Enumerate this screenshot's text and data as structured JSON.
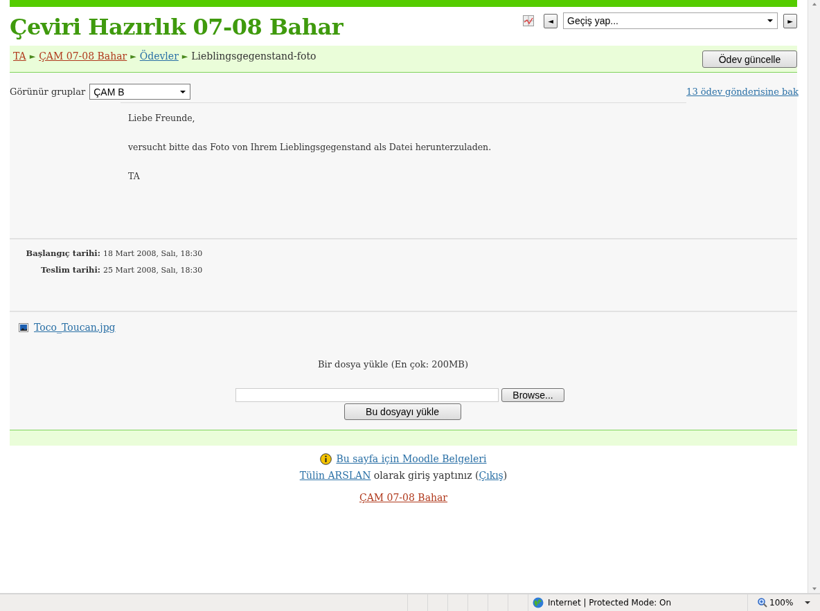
{
  "header": {
    "title": "Çeviri Hazırlık 07-08 Bahar",
    "jump": {
      "prev": "◄",
      "select": "Geçiş yap...",
      "next": "►"
    }
  },
  "breadcrumb": {
    "separator": "►",
    "items": [
      {
        "text": "TA",
        "kind": "course-link"
      },
      {
        "text": "ÇAM 07-08 Bahar",
        "kind": "course-link"
      },
      {
        "text": "Ödevler",
        "kind": "link"
      },
      {
        "text": "Lieblingsgegenstand-foto",
        "kind": "current"
      }
    ]
  },
  "update_button": "Ödev güncelle",
  "groups": {
    "label": "Görünür gruplar",
    "value": "ÇAM B"
  },
  "submissions_link": "13 ödev gönderisine bak",
  "intro": [
    "Liebe Freunde,",
    "versucht bitte das Foto von Ihrem Lieblingsgegenstand als Datei herunterzuladen.",
    "TA"
  ],
  "dates": [
    {
      "label": "Başlangıç tarihi:",
      "value": "18 Mart 2008, Salı, 18:30"
    },
    {
      "label": "Teslim tarihi:",
      "value": "25 Mart 2008, Salı, 18:30"
    }
  ],
  "files": [
    {
      "name": "Toco_Toucan.jpg"
    }
  ],
  "upload": {
    "title": "Bir dosya yükle (En çok: 200MB)",
    "browse": "Browse...",
    "submit": "Bu dosyayı yükle"
  },
  "footer": {
    "docs": "Bu sayfa için Moodle Belgeleri",
    "user": "Tülin ARSLAN",
    "login_text": " olarak giriş yaptınız (",
    "logout": "Çıkış",
    "close": ")",
    "course": "ÇAM 07-08 Bahar"
  },
  "status_bar": {
    "zone": "Internet | Protected Mode: On",
    "zoom": "100%"
  }
}
